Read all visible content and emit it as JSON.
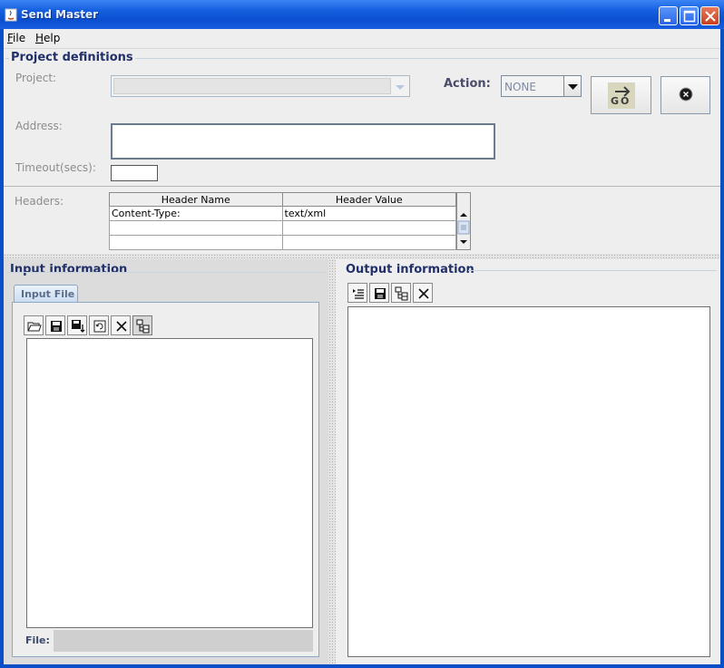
{
  "window": {
    "title": "Send Master"
  },
  "menubar": {
    "file": {
      "mnemonic": "F",
      "rest": "ile"
    },
    "help": {
      "mnemonic": "H",
      "rest": "elp"
    }
  },
  "project_definitions": {
    "title": "Project definitions",
    "project_label": "Project:",
    "project_value": "",
    "action_label": "Action:",
    "action_value": "NONE",
    "address_label": "Address:",
    "address_value": "",
    "timeout_label": "Timeout(secs):",
    "timeout_value": "",
    "go_text": "GO"
  },
  "headers": {
    "label": "Headers:",
    "columns": [
      "Header Name",
      "Header Value"
    ],
    "rows": [
      [
        "Content-Type:",
        "text/xml"
      ],
      [
        "",
        ""
      ],
      [
        "",
        ""
      ]
    ]
  },
  "input": {
    "title": "Input information",
    "tab_label": "Input File",
    "file_label": "File:",
    "file_value": ""
  },
  "output": {
    "title": "Output information"
  },
  "icons": {
    "open": "folder-open-icon",
    "save": "save-icon",
    "save_as": "save-down-icon",
    "refresh": "refresh-icon",
    "clear": "clear-x-icon",
    "tree": "tree-view-icon",
    "format": "format-indent-icon",
    "go": "go-arrow-icon",
    "stop": "stop-icon"
  }
}
